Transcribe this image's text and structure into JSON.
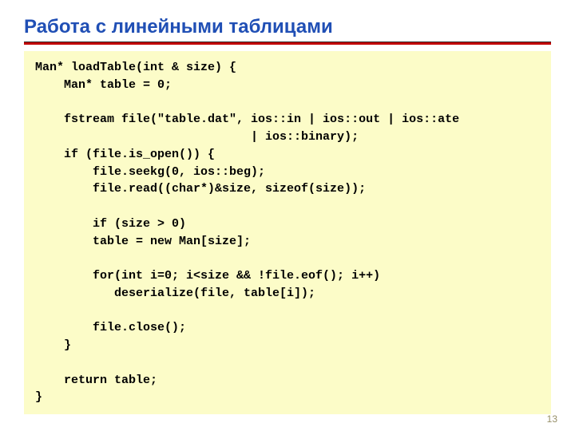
{
  "title": "Работа с линейными таблицами",
  "code": "Man* loadTable(int & size) {\n    Man* table = 0;\n\n    fstream file(\"table.dat\", ios::in | ios::out | ios::ate\n                              | ios::binary);\n    if (file.is_open()) {\n        file.seekg(0, ios::beg);\n        file.read((char*)&size, sizeof(size));\n\n        if (size > 0)\n        table = new Man[size];\n\n        for(int i=0; i<size && !file.eof(); i++)\n           deserialize(file, table[i]);\n\n        file.close();\n    }\n\n    return table;\n}",
  "page_number": "13"
}
